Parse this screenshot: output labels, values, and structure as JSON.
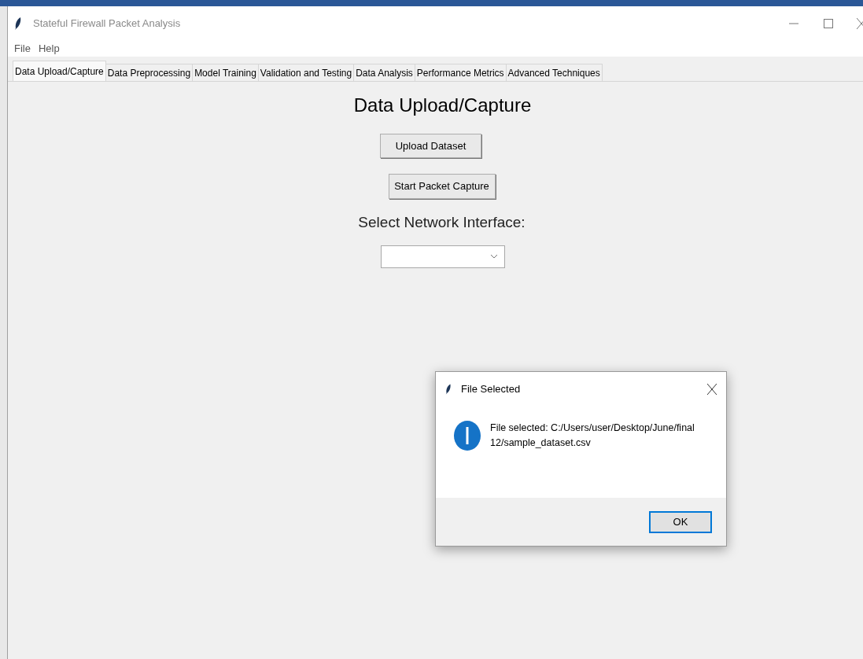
{
  "window": {
    "title": "Stateful Firewall Packet Analysis"
  },
  "menu": [
    "File",
    "Help"
  ],
  "tabs": [
    {
      "label": "Data Upload/Capture",
      "selected": true
    },
    {
      "label": "Data Preprocessing",
      "selected": false
    },
    {
      "label": "Model Training",
      "selected": false
    },
    {
      "label": "Validation and Testing",
      "selected": false
    },
    {
      "label": "Data Analysis",
      "selected": false
    },
    {
      "label": "Performance Metrics",
      "selected": false
    },
    {
      "label": "Advanced Techniques",
      "selected": false
    }
  ],
  "panel": {
    "heading": "Data Upload/Capture",
    "buttons": [
      "Upload Dataset",
      "Start Packet Capture"
    ],
    "interface_label": "Select Network Interface:"
  },
  "dialog": {
    "title": "File Selected",
    "message": "File selected: C:/Users/user/Desktop/June/final 12/sample_dataset.csv",
    "button": "OK"
  }
}
